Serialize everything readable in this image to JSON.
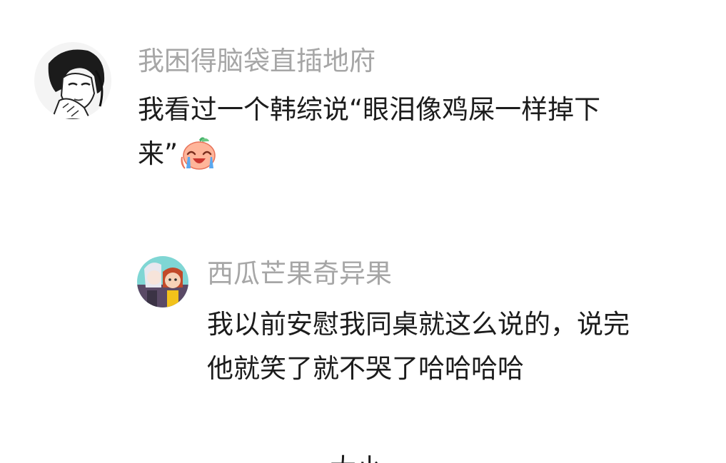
{
  "comments": [
    {
      "username": "我困得脑袋直插地府",
      "avatar_icon": "manga-portrait-avatar",
      "text_lines": [
        "我看过一个韩综说“眼泪像鸡屎一样掉下",
        "来”"
      ],
      "emoji_icon": "crying-laughing-peach-emoji"
    },
    {
      "username": "西瓜芒果奇异果",
      "avatar_icon": "anime-duo-avatar",
      "text_lines": [
        "我以前安慰我同桌就这么说的，说完",
        "他就笑了就不哭了哈哈哈哈"
      ]
    }
  ],
  "next_peek": "大小"
}
